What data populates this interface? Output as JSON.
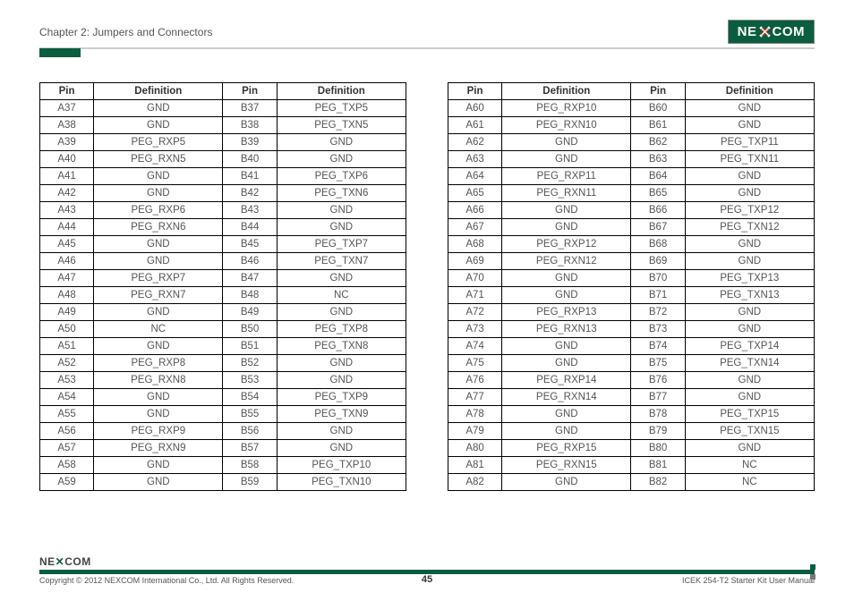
{
  "header": {
    "chapter": "Chapter 2: Jumpers and Connectors",
    "logo_left": "NE",
    "logo_right": "COM"
  },
  "columns": {
    "pin": "Pin",
    "definition": "Definition"
  },
  "table1": [
    {
      "ap": "A37",
      "ad": "GND",
      "bp": "B37",
      "bd": "PEG_TXP5"
    },
    {
      "ap": "A38",
      "ad": "GND",
      "bp": "B38",
      "bd": "PEG_TXN5"
    },
    {
      "ap": "A39",
      "ad": "PEG_RXP5",
      "bp": "B39",
      "bd": "GND"
    },
    {
      "ap": "A40",
      "ad": "PEG_RXN5",
      "bp": "B40",
      "bd": "GND"
    },
    {
      "ap": "A41",
      "ad": "GND",
      "bp": "B41",
      "bd": "PEG_TXP6"
    },
    {
      "ap": "A42",
      "ad": "GND",
      "bp": "B42",
      "bd": "PEG_TXN6"
    },
    {
      "ap": "A43",
      "ad": "PEG_RXP6",
      "bp": "B43",
      "bd": "GND"
    },
    {
      "ap": "A44",
      "ad": "PEG_RXN6",
      "bp": "B44",
      "bd": "GND"
    },
    {
      "ap": "A45",
      "ad": "GND",
      "bp": "B45",
      "bd": "PEG_TXP7"
    },
    {
      "ap": "A46",
      "ad": "GND",
      "bp": "B46",
      "bd": "PEG_TXN7"
    },
    {
      "ap": "A47",
      "ad": "PEG_RXP7",
      "bp": "B47",
      "bd": "GND"
    },
    {
      "ap": "A48",
      "ad": "PEG_RXN7",
      "bp": "B48",
      "bd": "NC"
    },
    {
      "ap": "A49",
      "ad": "GND",
      "bp": "B49",
      "bd": "GND"
    },
    {
      "ap": "A50",
      "ad": "NC",
      "bp": "B50",
      "bd": "PEG_TXP8"
    },
    {
      "ap": "A51",
      "ad": "GND",
      "bp": "B51",
      "bd": "PEG_TXN8"
    },
    {
      "ap": "A52",
      "ad": "PEG_RXP8",
      "bp": "B52",
      "bd": "GND"
    },
    {
      "ap": "A53",
      "ad": "PEG_RXN8",
      "bp": "B53",
      "bd": "GND"
    },
    {
      "ap": "A54",
      "ad": "GND",
      "bp": "B54",
      "bd": "PEG_TXP9"
    },
    {
      "ap": "A55",
      "ad": "GND",
      "bp": "B55",
      "bd": "PEG_TXN9"
    },
    {
      "ap": "A56",
      "ad": "PEG_RXP9",
      "bp": "B56",
      "bd": "GND"
    },
    {
      "ap": "A57",
      "ad": "PEG_RXN9",
      "bp": "B57",
      "bd": "GND"
    },
    {
      "ap": "A58",
      "ad": "GND",
      "bp": "B58",
      "bd": "PEG_TXP10"
    },
    {
      "ap": "A59",
      "ad": "GND",
      "bp": "B59",
      "bd": "PEG_TXN10"
    }
  ],
  "table2": [
    {
      "ap": "A60",
      "ad": "PEG_RXP10",
      "bp": "B60",
      "bd": "GND"
    },
    {
      "ap": "A61",
      "ad": "PEG_RXN10",
      "bp": "B61",
      "bd": "GND"
    },
    {
      "ap": "A62",
      "ad": "GND",
      "bp": "B62",
      "bd": "PEG_TXP11"
    },
    {
      "ap": "A63",
      "ad": "GND",
      "bp": "B63",
      "bd": "PEG_TXN11"
    },
    {
      "ap": "A64",
      "ad": "PEG_RXP11",
      "bp": "B64",
      "bd": "GND"
    },
    {
      "ap": "A65",
      "ad": "PEG_RXN11",
      "bp": "B65",
      "bd": "GND"
    },
    {
      "ap": "A66",
      "ad": "GND",
      "bp": "B66",
      "bd": "PEG_TXP12"
    },
    {
      "ap": "A67",
      "ad": "GND",
      "bp": "B67",
      "bd": "PEG_TXN12"
    },
    {
      "ap": "A68",
      "ad": "PEG_RXP12",
      "bp": "B68",
      "bd": "GND"
    },
    {
      "ap": "A69",
      "ad": "PEG_RXN12",
      "bp": "B69",
      "bd": "GND"
    },
    {
      "ap": "A70",
      "ad": "GND",
      "bp": "B70",
      "bd": "PEG_TXP13"
    },
    {
      "ap": "A71",
      "ad": "GND",
      "bp": "B71",
      "bd": "PEG_TXN13"
    },
    {
      "ap": "A72",
      "ad": "PEG_RXP13",
      "bp": "B72",
      "bd": "GND"
    },
    {
      "ap": "A73",
      "ad": "PEG_RXN13",
      "bp": "B73",
      "bd": "GND"
    },
    {
      "ap": "A74",
      "ad": "GND",
      "bp": "B74",
      "bd": "PEG_TXP14"
    },
    {
      "ap": "A75",
      "ad": "GND",
      "bp": "B75",
      "bd": "PEG_TXN14"
    },
    {
      "ap": "A76",
      "ad": "PEG_RXP14",
      "bp": "B76",
      "bd": "GND"
    },
    {
      "ap": "A77",
      "ad": "PEG_RXN14",
      "bp": "B77",
      "bd": "GND"
    },
    {
      "ap": "A78",
      "ad": "GND",
      "bp": "B78",
      "bd": "PEG_TXP15"
    },
    {
      "ap": "A79",
      "ad": "GND",
      "bp": "B79",
      "bd": "PEG_TXN15"
    },
    {
      "ap": "A80",
      "ad": "PEG_RXP15",
      "bp": "B80",
      "bd": "GND"
    },
    {
      "ap": "A81",
      "ad": "PEG_RXN15",
      "bp": "B81",
      "bd": "NC"
    },
    {
      "ap": "A82",
      "ad": "GND",
      "bp": "B82",
      "bd": "NC"
    }
  ],
  "footer": {
    "logo_left": "NE",
    "logo_right": "COM",
    "copyright": "Copyright © 2012 NEXCOM International Co., Ltd. All Rights Reserved.",
    "page": "45",
    "manual": "ICEK 254-T2 Starter Kit User Manual"
  }
}
